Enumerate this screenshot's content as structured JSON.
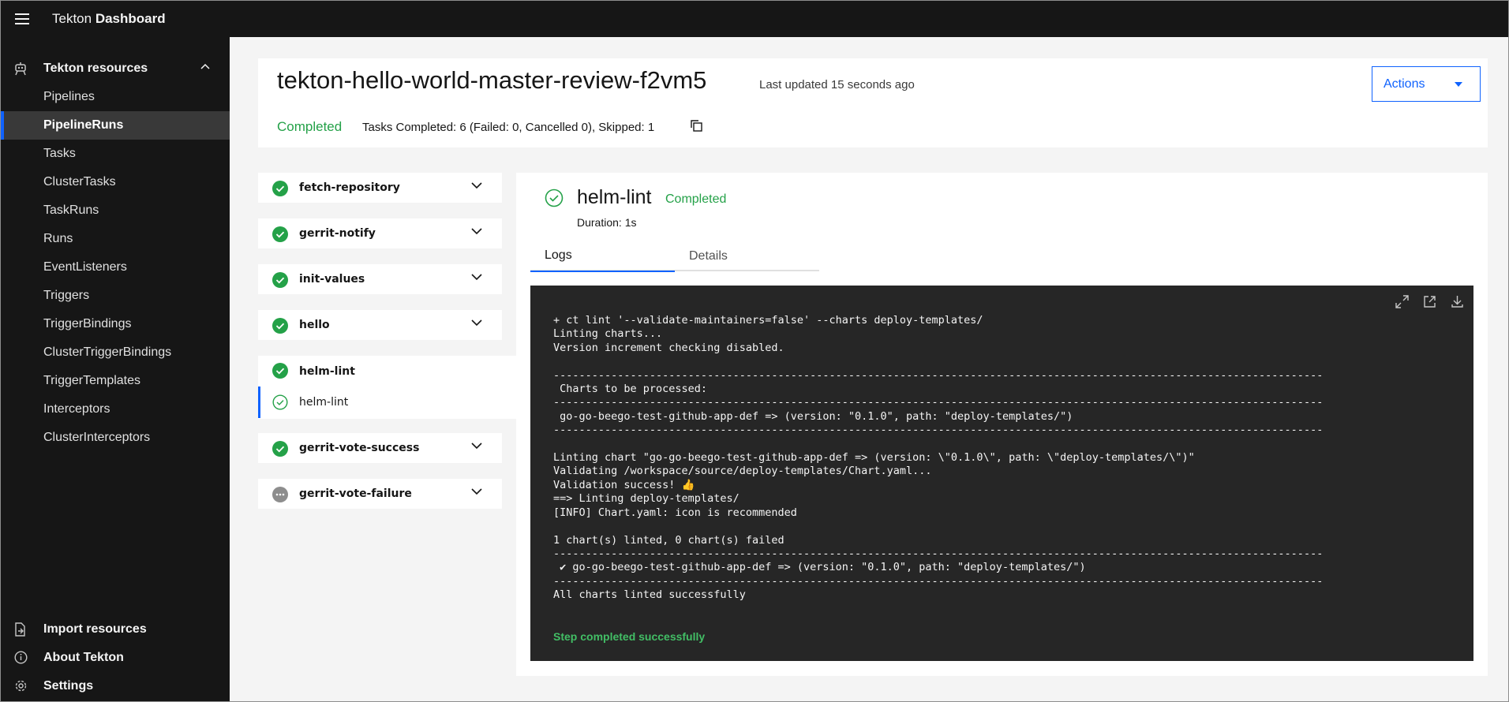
{
  "header": {
    "brand_prefix": "Tekton",
    "brand_bold": "Dashboard"
  },
  "sidebar": {
    "section_label": "Tekton resources",
    "items": [
      {
        "label": "Pipelines",
        "active": false
      },
      {
        "label": "PipelineRuns",
        "active": true
      },
      {
        "label": "Tasks",
        "active": false
      },
      {
        "label": "ClusterTasks",
        "active": false
      },
      {
        "label": "TaskRuns",
        "active": false
      },
      {
        "label": "Runs",
        "active": false
      },
      {
        "label": "EventListeners",
        "active": false
      },
      {
        "label": "Triggers",
        "active": false
      },
      {
        "label": "TriggerBindings",
        "active": false
      },
      {
        "label": "ClusterTriggerBindings",
        "active": false
      },
      {
        "label": "TriggerTemplates",
        "active": false
      },
      {
        "label": "Interceptors",
        "active": false
      },
      {
        "label": "ClusterInterceptors",
        "active": false
      }
    ],
    "bottom": {
      "import": "Import resources",
      "about": "About Tekton",
      "settings": "Settings"
    }
  },
  "pipeline_run": {
    "name": "tekton-hello-world-master-review-f2vm5",
    "last_updated": "Last updated 15 seconds ago",
    "actions_label": "Actions",
    "status": "Completed",
    "summary": "Tasks Completed: 6 (Failed: 0, Cancelled 0), Skipped: 1"
  },
  "tasks": [
    {
      "label": "fetch-repository",
      "status": "success"
    },
    {
      "label": "gerrit-notify",
      "status": "success"
    },
    {
      "label": "init-values",
      "status": "success"
    },
    {
      "label": "hello",
      "status": "success"
    },
    {
      "label": "helm-lint",
      "status": "success",
      "expanded": true,
      "steps": [
        {
          "label": "helm-lint"
        }
      ]
    },
    {
      "label": "gerrit-vote-success",
      "status": "success"
    },
    {
      "label": "gerrit-vote-failure",
      "status": "skipped"
    }
  ],
  "step_detail": {
    "name": "helm-lint",
    "status": "Completed",
    "duration": "Duration: 1s",
    "tabs": {
      "logs": "Logs",
      "details": "Details"
    },
    "log_text": "+ ct lint '--validate-maintainers=false' --charts deploy-templates/\nLinting charts...\nVersion increment checking disabled.\n\n------------------------------------------------------------------------------------------------------------------------\n Charts to be processed:\n------------------------------------------------------------------------------------------------------------------------\n go-go-beego-test-github-app-def => (version: \"0.1.0\", path: \"deploy-templates/\")\n------------------------------------------------------------------------------------------------------------------------\n\nLinting chart \"go-go-beego-test-github-app-def => (version: \\\"0.1.0\\\", path: \\\"deploy-templates/\\\")\"\nValidating /workspace/source/deploy-templates/Chart.yaml...\nValidation success! 👍\n==> Linting deploy-templates/\n[INFO] Chart.yaml: icon is recommended\n\n1 chart(s) linted, 0 chart(s) failed\n------------------------------------------------------------------------------------------------------------------------\n ✔ go-go-beego-test-github-app-def => (version: \"0.1.0\", path: \"deploy-templates/\")\n------------------------------------------------------------------------------------------------------------------------\nAll charts linted successfully",
    "log_footer": "Step completed successfully"
  },
  "colors": {
    "success": "#24a148",
    "accent": "#0f62fe",
    "header_bg": "#161616",
    "log_bg": "#262626"
  }
}
